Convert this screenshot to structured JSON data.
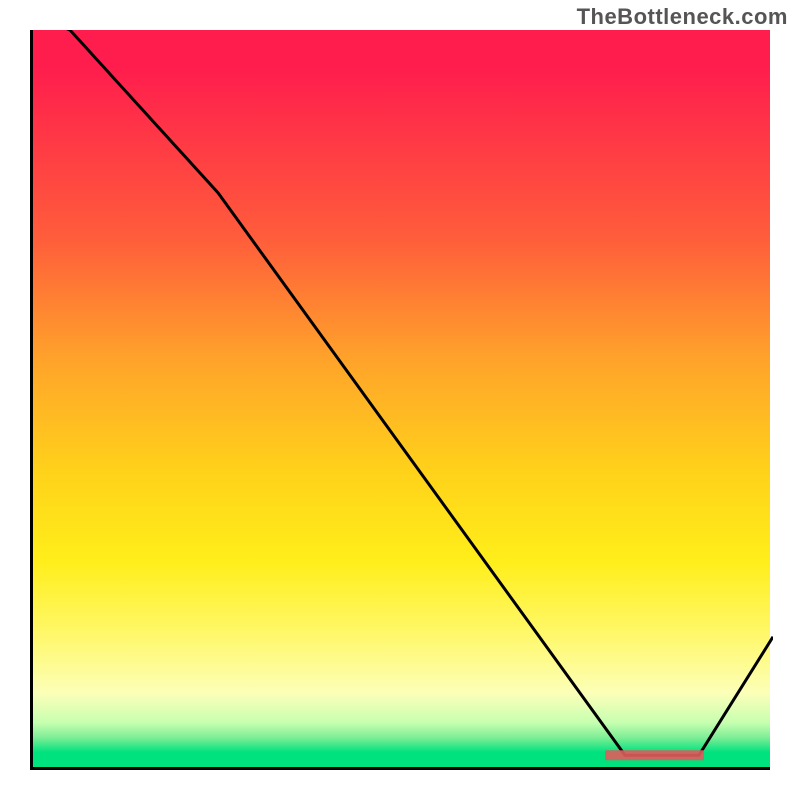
{
  "watermark": "TheBottleneck.com",
  "chart_data": {
    "type": "line",
    "title": "",
    "xlabel": "",
    "ylabel": "",
    "xlim": [
      0,
      100
    ],
    "ylim": [
      0,
      100
    ],
    "x": [
      0,
      5,
      25,
      80,
      90,
      100
    ],
    "values": [
      102,
      100,
      78,
      2,
      2,
      18
    ],
    "minimum_region_x": [
      78,
      90
    ],
    "minimum_region_y": 2,
    "gradient_colors": {
      "top": "#ff1d4d",
      "mid_high": "#ffa42a",
      "mid": "#ffee1a",
      "mid_low": "#fcffb8",
      "bottom": "#00e27e"
    },
    "marker_color": "#e05c5c",
    "curve_color": "#000000"
  }
}
